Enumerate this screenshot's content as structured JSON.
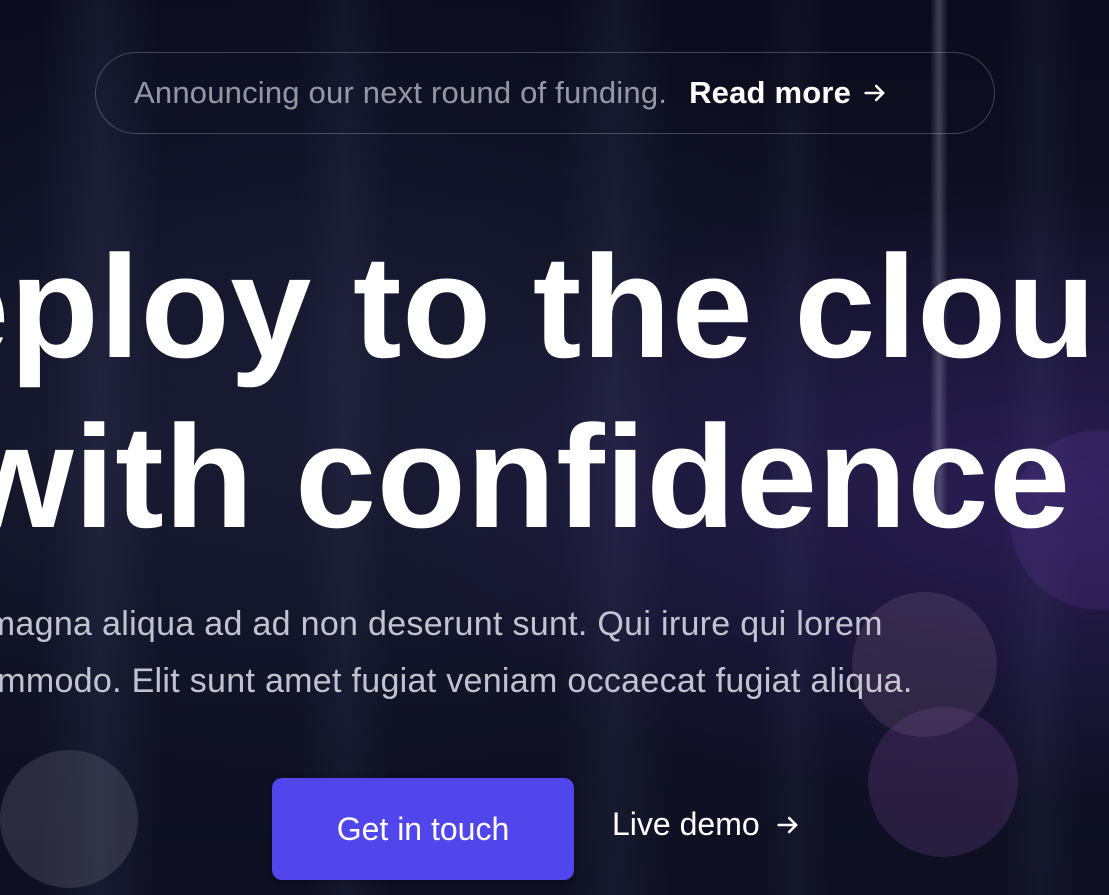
{
  "announcement": {
    "text": "Announcing our next round of funding.",
    "link_label": "Read more",
    "link_icon": "arrow-right-icon"
  },
  "hero": {
    "headline_line1": "eploy to the clou",
    "headline_line2": "with confidence",
    "description_line1": "id magna aliqua ad ad non deserunt sunt. Qui irure qui lorem",
    "description_line2": "ommodo. Elit sunt amet fugiat veniam occaecat fugiat aliqua."
  },
  "actions": {
    "primary_label": "Get in touch",
    "secondary_label": "Live demo",
    "secondary_icon": "arrow-right-icon"
  },
  "colors": {
    "background": "#0d0e24",
    "accent": "#5046ec",
    "text": "#ffffff"
  }
}
